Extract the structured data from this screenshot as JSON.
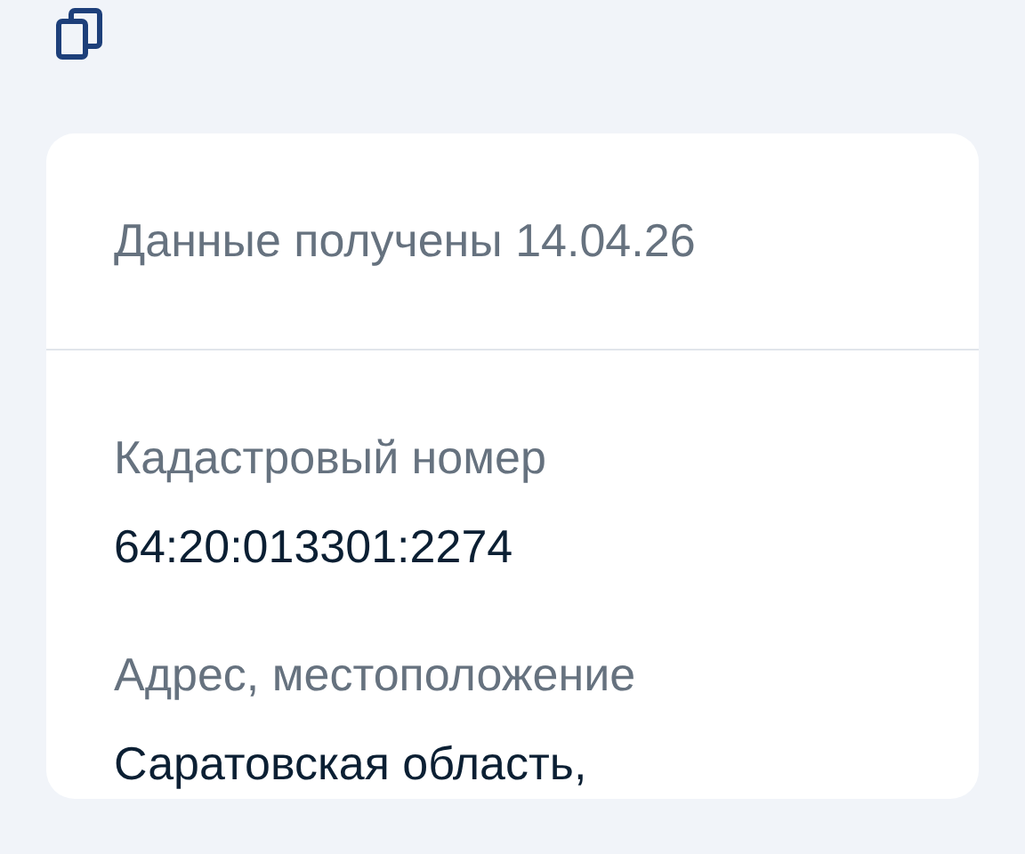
{
  "status": "Данные получены 14.04.26",
  "fields": [
    {
      "label": "Кадастровый номер",
      "value": "64:20:013301:2274"
    },
    {
      "label": "Адрес, местоположение",
      "value": "Саратовская область,"
    }
  ]
}
